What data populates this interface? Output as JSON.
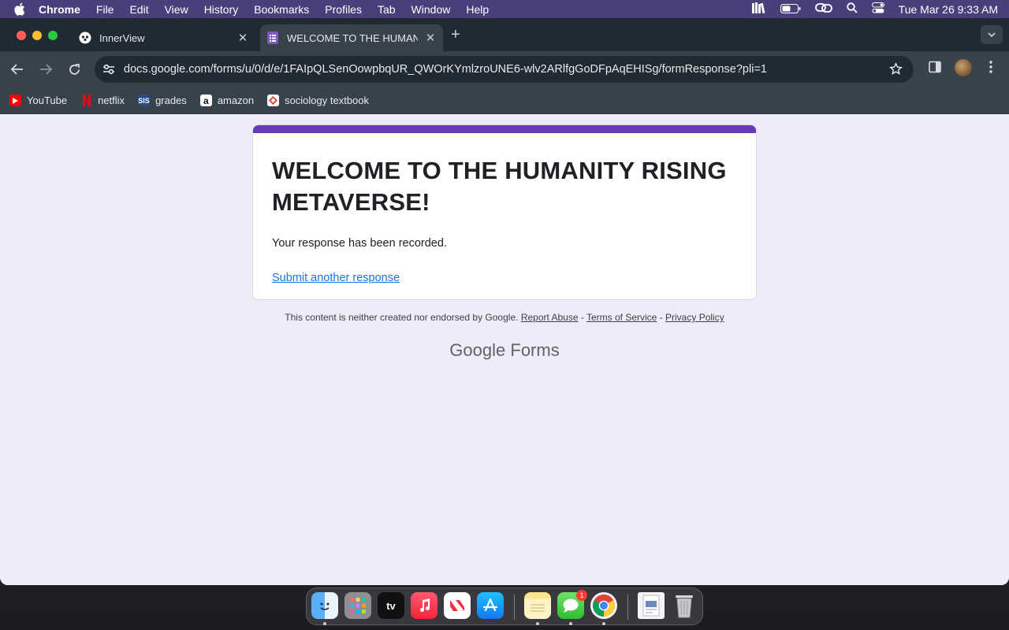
{
  "menubar": {
    "app_name": "Chrome",
    "menus": [
      "File",
      "Edit",
      "View",
      "History",
      "Bookmarks",
      "Profiles",
      "Tab",
      "Window",
      "Help"
    ],
    "clock": "Tue Mar 26  9:33 AM"
  },
  "tabs": [
    {
      "title": "InnerView",
      "active": false
    },
    {
      "title": "WELCOME TO THE HUMANITY RISING METAVERSE!",
      "active": true
    }
  ],
  "address_bar": {
    "url": "docs.google.com/forms/u/0/d/e/1FAIpQLSenOowpbqUR_QWOrKYmlzroUNE6-wlv2ARlfgGoDFpAqEHISg/formResponse?pli=1"
  },
  "bookmarks": [
    {
      "label": "YouTube",
      "icon": "youtube-icon"
    },
    {
      "label": "netflix",
      "icon": "netflix-icon"
    },
    {
      "label": "grades",
      "icon": "sis-icon",
      "icon_text": "SIS"
    },
    {
      "label": "amazon",
      "icon": "amazon-icon",
      "icon_text": "a"
    },
    {
      "label": "sociology textbook",
      "icon": "textbook-icon"
    }
  ],
  "form": {
    "title": "WELCOME TO THE HUMANITY RISING METAVERSE!",
    "confirmation": "Your response has been recorded.",
    "submit_another": "Submit another response",
    "accent_color": "#673ab7"
  },
  "footer": {
    "disclaimer": "This content is neither created nor endorsed by Google.",
    "report_abuse": "Report Abuse",
    "terms": "Terms of Service",
    "privacy": "Privacy Policy",
    "separator": " - ",
    "brand_google": "Google",
    "brand_forms": "Forms"
  },
  "dock": {
    "tv_label": "tv",
    "messages_badge": "1",
    "apps": [
      "finder-icon",
      "launchpad-icon",
      "apple-tv-icon",
      "music-icon",
      "news-icon",
      "app-store-icon",
      "notes-icon",
      "messages-icon",
      "chrome-icon",
      "preview-pdf-icon",
      "trash-icon"
    ]
  }
}
